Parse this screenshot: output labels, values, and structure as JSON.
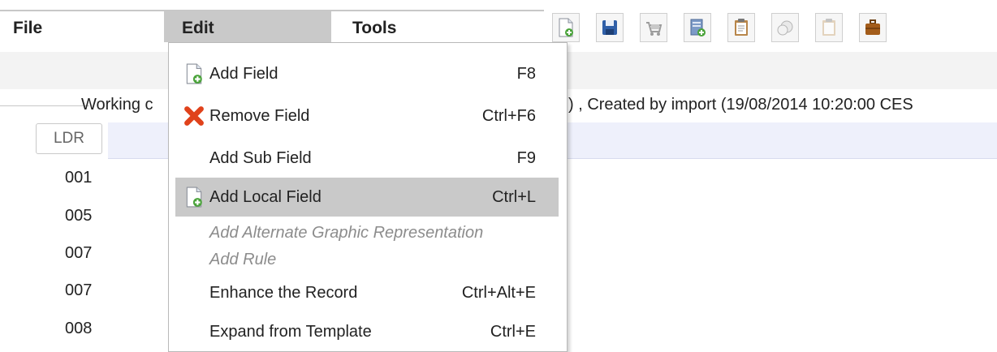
{
  "menubar": {
    "file": "File",
    "edit": "Edit",
    "tools": "Tools"
  },
  "toolbar": {
    "buttons": [
      {
        "icon": "new-document-icon"
      },
      {
        "icon": "save-icon"
      },
      {
        "icon": "cart-icon",
        "disabled": true
      },
      {
        "icon": "new-record-icon"
      },
      {
        "icon": "clipboard-icon"
      },
      {
        "icon": "copy-icon",
        "disabled": true
      },
      {
        "icon": "clipboard-paste-icon",
        "disabled": true
      },
      {
        "icon": "briefcase-icon"
      }
    ]
  },
  "status": {
    "left": "Working c",
    "right": ") , Created by import (19/08/2014 10:20:00 CES"
  },
  "record": {
    "ldr_label": "LDR",
    "tags": [
      "001",
      "005",
      "007",
      "007",
      "008"
    ]
  },
  "edit_menu": {
    "items": [
      {
        "label": "Add Field",
        "shortcut": "F8",
        "icon": "add-field-icon"
      },
      {
        "label": "Remove Field",
        "shortcut": "Ctrl+F6",
        "icon": "remove-x-icon"
      },
      {
        "label": "Add Sub Field",
        "shortcut": "F9",
        "icon": ""
      },
      {
        "label": "Add Local Field",
        "shortcut": "Ctrl+L",
        "icon": "add-field-icon",
        "highlighted": true
      },
      {
        "label": "Add Alternate Graphic Representation",
        "shortcut": "",
        "disabled": true
      },
      {
        "label": "Add Rule",
        "shortcut": "",
        "disabled": true
      },
      {
        "label": "Enhance the Record",
        "shortcut": "Ctrl+Alt+E",
        "icon": ""
      },
      {
        "label": "Expand from Template",
        "shortcut": "Ctrl+E",
        "icon": ""
      }
    ]
  },
  "colors": {
    "menu_highlight": "#c9c9c9",
    "record_row": "#eef0fb",
    "disabled_text": "#8c8c8c"
  }
}
